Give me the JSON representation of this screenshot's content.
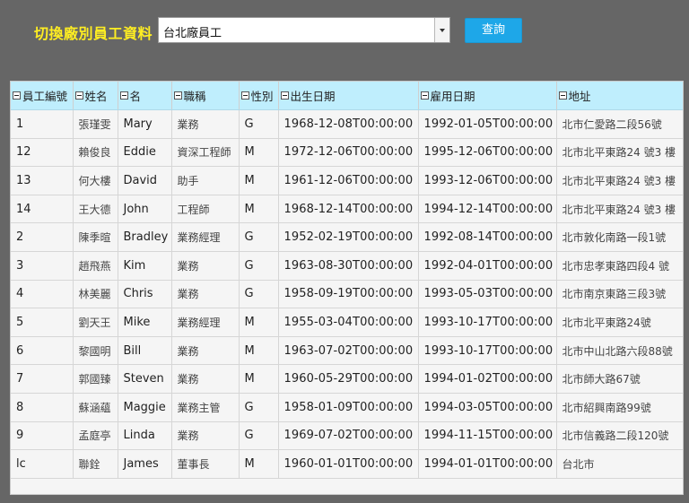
{
  "toolbar": {
    "label": "切換廠別員工資料",
    "select_value": "台北廠員工",
    "query_button": "查詢"
  },
  "grid": {
    "columns": [
      "員工編號",
      "姓名",
      "名",
      "職稱",
      "性別",
      "出生日期",
      "雇用日期",
      "地址"
    ],
    "rows": [
      [
        "1",
        "張瑾雯",
        "Mary",
        "業務",
        "G",
        "1968-12-08T00:00:00",
        "1992-01-05T00:00:00",
        "北市仁愛路二段56號"
      ],
      [
        "12",
        "賴俊良",
        "Eddie",
        "資深工程師",
        "M",
        "1972-12-06T00:00:00",
        "1995-12-06T00:00:00",
        "北市北平東路24 號3 樓"
      ],
      [
        "13",
        "何大樓",
        "David",
        "助手",
        "M",
        "1961-12-06T00:00:00",
        "1993-12-06T00:00:00",
        "北市北平東路24 號3 樓"
      ],
      [
        "14",
        "王大德",
        "John",
        "工程師",
        "M",
        "1968-12-14T00:00:00",
        "1994-12-14T00:00:00",
        "北市北平東路24 號3 樓"
      ],
      [
        "2",
        "陳季暄",
        "Bradley",
        "業務經理",
        "G",
        "1952-02-19T00:00:00",
        "1992-08-14T00:00:00",
        "北市敦化南路一段1號"
      ],
      [
        "3",
        "趙飛燕",
        "Kim",
        "業務",
        "G",
        "1963-08-30T00:00:00",
        "1992-04-01T00:00:00",
        "北市忠孝東路四段4 號"
      ],
      [
        "4",
        "林美麗",
        "Chris",
        "業務",
        "G",
        "1958-09-19T00:00:00",
        "1993-05-03T00:00:00",
        "北市南京東路三段3號"
      ],
      [
        "5",
        "劉天王",
        "Mike",
        "業務經理",
        "M",
        "1955-03-04T00:00:00",
        "1993-10-17T00:00:00",
        "北市北平東路24號"
      ],
      [
        "6",
        "黎國明",
        "Bill",
        "業務",
        "M",
        "1963-07-02T00:00:00",
        "1993-10-17T00:00:00",
        "北市中山北路六段88號"
      ],
      [
        "7",
        "郭國臻",
        "Steven",
        "業務",
        "M",
        "1960-05-29T00:00:00",
        "1994-01-02T00:00:00",
        "北市師大路67號"
      ],
      [
        "8",
        "蘇涵蘊",
        "Maggie",
        "業務主管",
        "G",
        "1958-01-09T00:00:00",
        "1994-03-05T00:00:00",
        "北市紹興南路99號"
      ],
      [
        "9",
        "孟庭亭",
        "Linda",
        "業務",
        "G",
        "1969-07-02T00:00:00",
        "1994-11-15T00:00:00",
        "北市信義路二段120號"
      ],
      [
        "lc",
        "聯銓",
        "James",
        "董事長",
        "M",
        "1960-01-01T00:00:00",
        "1994-01-01T00:00:00",
        "台北市"
      ]
    ]
  }
}
